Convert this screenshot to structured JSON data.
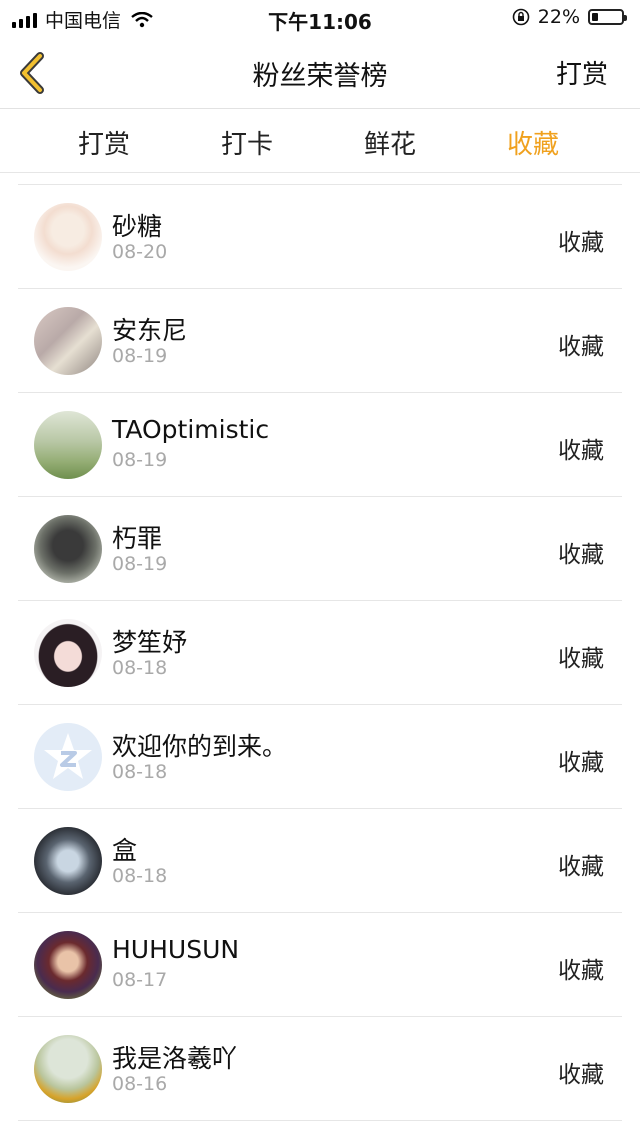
{
  "status": {
    "carrier": "中国电信",
    "time": "下午11:06",
    "battery_text": "22%",
    "battery_level": 0.22
  },
  "nav": {
    "title": "粉丝荣誉榜",
    "action": "打赏"
  },
  "tabs": [
    {
      "label": "打赏"
    },
    {
      "label": "打卡"
    },
    {
      "label": "鲜花"
    },
    {
      "label": "收藏"
    }
  ],
  "accent_color": "#f0a11e",
  "list": [
    {
      "name": "砂糖",
      "date": "08-20",
      "tag": "收藏",
      "avatar": "avatar-light"
    },
    {
      "name": "安东尼",
      "date": "08-19",
      "tag": "收藏",
      "avatar": "avatar-gray"
    },
    {
      "name": "TAOptimistic",
      "date": "08-19",
      "tag": "收藏",
      "avatar": "avatar-green"
    },
    {
      "name": "朽罪",
      "date": "08-19",
      "tag": "收藏",
      "avatar": "avatar-dark"
    },
    {
      "name": "梦笙妤",
      "date": "08-18",
      "tag": "收藏",
      "avatar": "avatar-anime"
    },
    {
      "name": "欢迎你的到来。",
      "date": "08-18",
      "tag": "收藏",
      "avatar": "avatar-default"
    },
    {
      "name": "盒",
      "date": "08-18",
      "tag": "收藏",
      "avatar": "avatar-blue"
    },
    {
      "name": "HUHUSUN",
      "date": "08-17",
      "tag": "收藏",
      "avatar": "avatar-portrait"
    },
    {
      "name": "我是洛羲吖",
      "date": "08-16",
      "tag": "收藏",
      "avatar": "avatar-sunflower"
    }
  ]
}
